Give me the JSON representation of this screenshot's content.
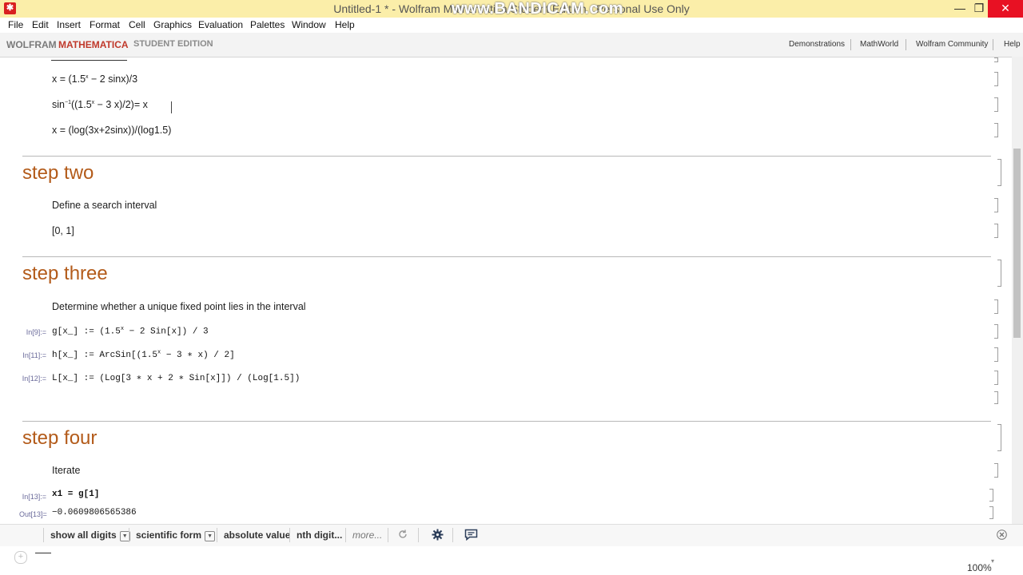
{
  "window": {
    "title": "Untitled-1 * - Wolfram Mathematica Student Edition - Personal Use Only",
    "watermark": "www.BANDICAM.com",
    "minimize": "—",
    "maximize": "❐",
    "close": "✕",
    "app_icon": "✱"
  },
  "menu": [
    "File",
    "Edit",
    "Insert",
    "Format",
    "Cell",
    "Graphics",
    "Evaluation",
    "Palettes",
    "Window",
    "Help"
  ],
  "banner": {
    "brand_wolfram": "WOLFRAM",
    "brand_mathematica": "MATHEMATICA",
    "brand_edition": "STUDENT EDITION",
    "links": [
      "Demonstrations",
      "MathWorld",
      "Wolfram Community",
      "Help"
    ]
  },
  "notebook": {
    "step1_lines": {
      "l1_a": "x = (1.5",
      "l1_sup": "x",
      "l1_b": " − 2 sinx)/3",
      "l2_a": "sin",
      "l2_sup1": "−1",
      "l2_b": "((1.5",
      "l2_sup2": "x",
      "l2_c": " − 3 x)/2)= x",
      "l3": "x = (log(3x+2sinx))/(log1.5)"
    },
    "step2": {
      "heading": "step two",
      "text": "Define a search interval",
      "interval": "[0, 1]"
    },
    "step3": {
      "heading": "step three",
      "text": "Determine whether a unique fixed point lies in the interval",
      "in9_label": "In[9]:=",
      "in9_a": "g[x_] := (1.5",
      "in9_sup": "x",
      "in9_b": " − 2 Sin[x]) / 3",
      "in11_label": "In[11]:=",
      "in11_a": "h[x_] := ArcSin[(1.5",
      "in11_sup": "x",
      "in11_b": " − 3 ∗ x) / 2]",
      "in12_label": "In[12]:=",
      "in12": "L[x_] := (Log[3 ∗ x + 2 ∗ Sin[x]]) / (Log[1.5])"
    },
    "step4": {
      "heading": "step four",
      "text": "Iterate",
      "in13_label": "In[13]:=",
      "in13": "x1 = g[1]",
      "out13_label": "Out[13]=",
      "out13": "−0.0609806565386"
    }
  },
  "suggestion_bar": {
    "items": [
      "show all digits",
      "scientific form",
      "absolute value",
      "nth digit...",
      "more..."
    ],
    "dropdown_glyph": "▼",
    "icons": [
      "refresh-icon",
      "gear-icon",
      "comment-icon"
    ]
  },
  "status": {
    "zoom": "100%"
  }
}
